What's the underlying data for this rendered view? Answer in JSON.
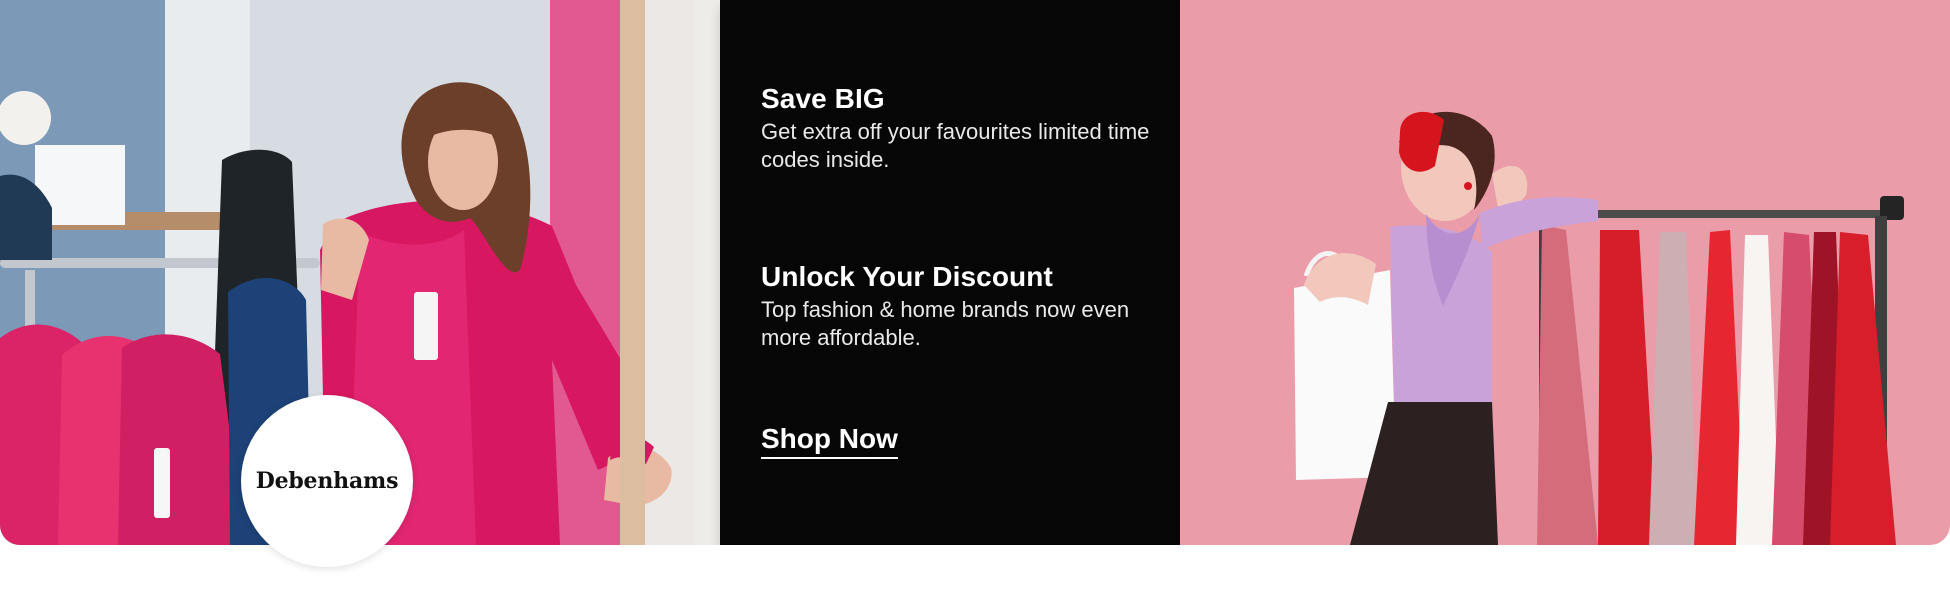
{
  "promo": {
    "save_title": "Save BIG",
    "save_text": "Get extra off your favourites limited time codes inside.",
    "discount_title": "Unlock Your Discount",
    "discount_text": "Top fashion & home brands now even more affordable.",
    "cta_label": "Shop Now"
  },
  "brand": {
    "name": "Debenhams"
  },
  "colors": {
    "dark_panel": "#060606",
    "left_pink": "#c6327d",
    "right_pink": "#ea98a3",
    "white": "#ffffff"
  },
  "icons": {
    "left_image": "fashion-shopper-photo",
    "right_image": "fashion-model-photo"
  }
}
